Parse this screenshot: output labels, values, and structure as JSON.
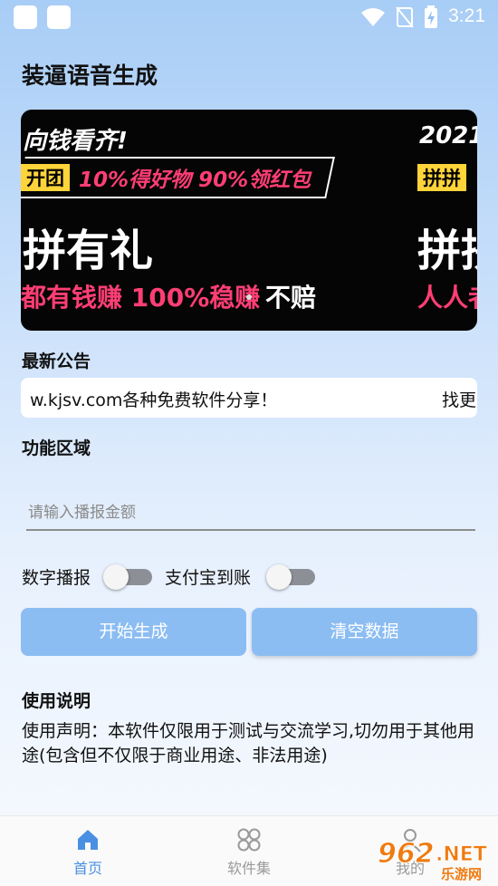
{
  "status_bar": {
    "time": "3:21"
  },
  "app": {
    "title": "装逼语音生成"
  },
  "banner": {
    "left": {
      "line1": "向钱看齐!",
      "tag": "开团",
      "promo": "10%得好物 90%领红包",
      "big": "拼有礼",
      "sub1": "都有钱赚 100%稳赚",
      "sub2": "不赔"
    },
    "right": {
      "line1": "2021,",
      "tag": "拼拼",
      "big": "拼拼",
      "sub": "人人者"
    }
  },
  "notice": {
    "label": "最新公告",
    "text": "w.kjsv.com各种免费软件分享！",
    "text2": "找更"
  },
  "function_area": {
    "label": "功能区域",
    "amount_placeholder": "请输入播报金额",
    "switch_digit_label": "数字播报",
    "switch_alipay_label": "支付宝到账",
    "start_button": "开始生成",
    "clear_button": "清空数据"
  },
  "instructions": {
    "title": "使用说明",
    "text": "使用声明：本软件仅限用于测试与交流学习,切勿用于其他用途(包含但不仅限于商业用途、非法用途)"
  },
  "bottom_nav": [
    {
      "label": "首页",
      "icon": "home-icon",
      "active": true
    },
    {
      "label": "软件集",
      "icon": "grid-icon",
      "active": false
    },
    {
      "label": "我的",
      "icon": "user-icon",
      "active": false
    }
  ],
  "watermark": {
    "text": "962.NET",
    "sub": "乐游网"
  },
  "colors": {
    "accent": "#4a90e2",
    "button": "#8cbdf2",
    "inactive": "#9a9a9a"
  }
}
